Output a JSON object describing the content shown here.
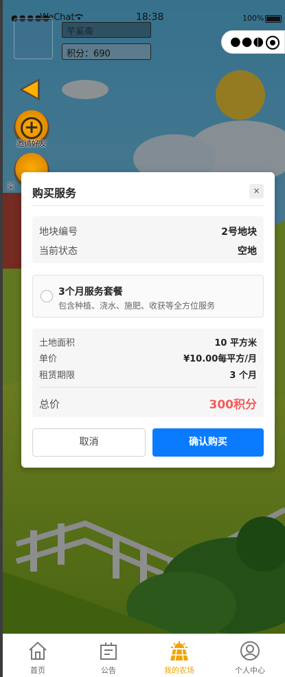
{
  "status_bar": {
    "signal": "●●●●●",
    "carrier": "WeChat",
    "time": "18:38",
    "battery": "100%"
  },
  "profile": {
    "name": "芊奚斋",
    "points": "积分：690"
  },
  "side_buttons": {
    "invite_label": "邀请好友",
    "second_label": "买"
  },
  "modal": {
    "title": "购买服务",
    "close": "×",
    "info": {
      "plot_label": "地块编号",
      "plot_value": "2号地块",
      "status_label": "当前状态",
      "status_value": "空地"
    },
    "package": {
      "title": "3个月服务套餐",
      "description": "包含种植、浇水、施肥、收获等全方位服务"
    },
    "details": {
      "area_label": "土地面积",
      "area_value": "10 平方米",
      "price_label": "单价",
      "price_value": "¥10.00每平方/月",
      "term_label": "租赁期限",
      "term_value": "3 个月",
      "total_label": "总价",
      "total_value": "300积分"
    },
    "cancel_label": "取消",
    "confirm_label": "确认购买"
  },
  "tabbar": {
    "items": [
      {
        "label": "首页",
        "icon": "home-icon"
      },
      {
        "label": "公告",
        "icon": "notice-icon"
      },
      {
        "label": "我的农场",
        "icon": "farm-icon"
      },
      {
        "label": "个人中心",
        "icon": "user-icon"
      }
    ],
    "active_color": "#f0a500"
  },
  "colors": {
    "accent": "#0a7bff",
    "price": "#f45b5b"
  }
}
